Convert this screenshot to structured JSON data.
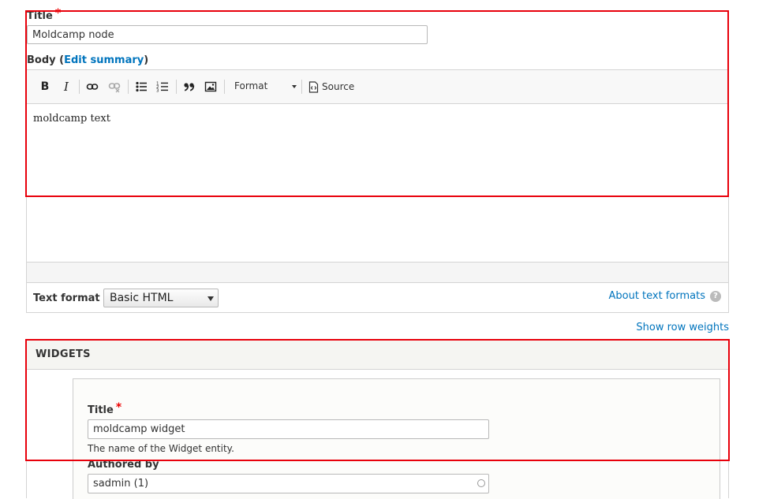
{
  "node": {
    "title_label": "Title",
    "required_mark": "*",
    "title_value": "Moldcamp node",
    "body_label": "Body",
    "edit_summary": "Edit summary",
    "paren_open": "(",
    "paren_close": ")"
  },
  "toolbar": {
    "bold": "B",
    "italic": "I",
    "format_label": "Format",
    "source_label": "Source",
    "icons": [
      "bold",
      "italic",
      "link",
      "unlink",
      "bulleted-list",
      "numbered-list",
      "blockquote",
      "image",
      "format-dropdown",
      "source"
    ]
  },
  "editor": {
    "content": "moldcamp text"
  },
  "text_format": {
    "label": "Text format",
    "selected": "Basic HTML",
    "about_link": "About text formats",
    "help_glyph": "?"
  },
  "row_weights_link": "Show row weights",
  "widgets": {
    "heading": "WIDGETS",
    "title_label": "Title",
    "required_mark": "*",
    "title_value": "moldcamp widget",
    "title_desc": "The name of the Widget entity.",
    "authored_label": "Authored by",
    "authored_value": "sadmin (1)"
  },
  "colors": {
    "highlight": "#e8000b",
    "link": "#0074bd",
    "required": "#e00000"
  }
}
